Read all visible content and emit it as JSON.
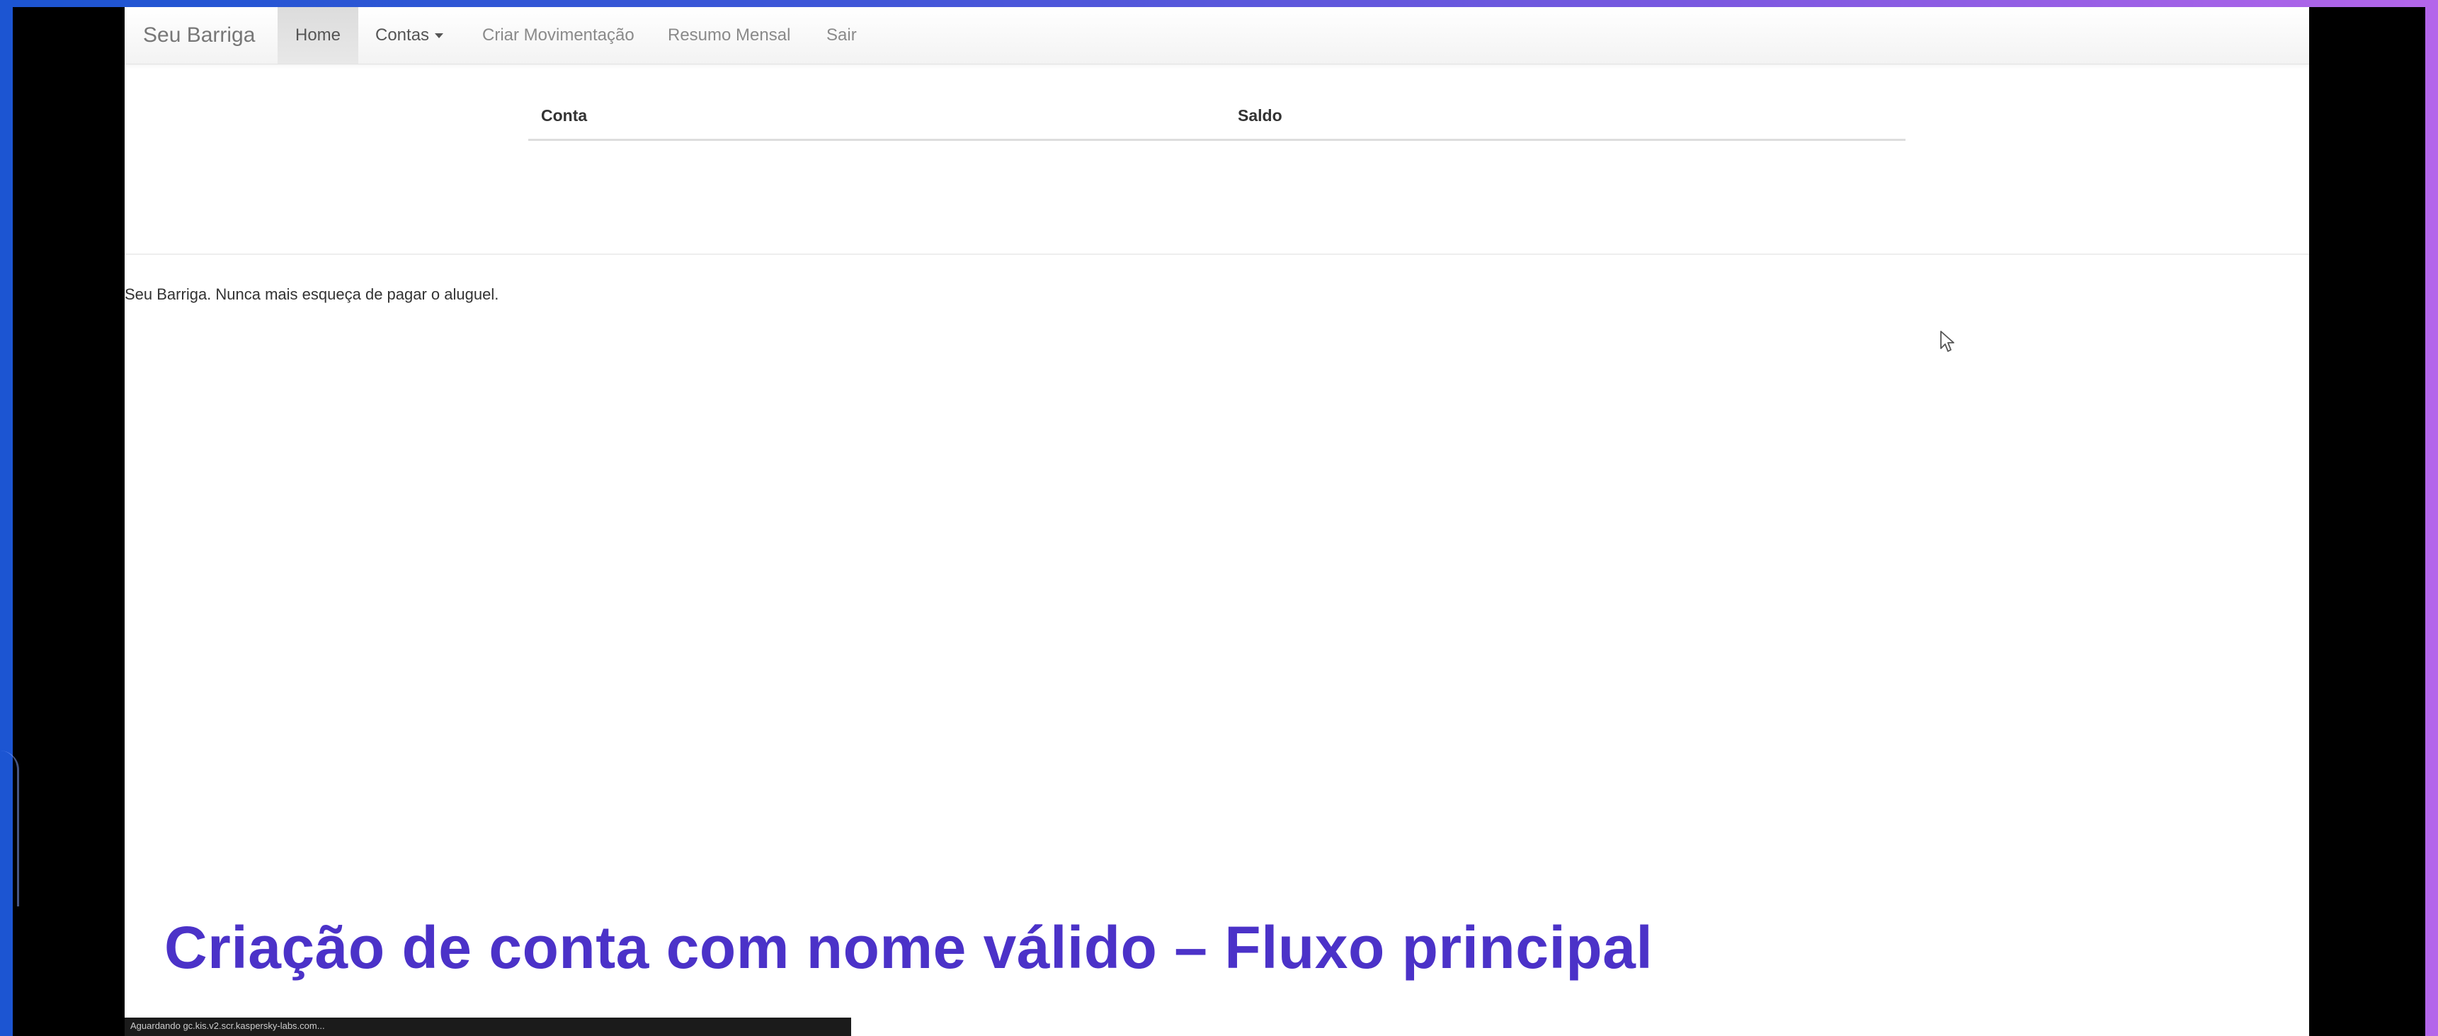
{
  "navbar": {
    "brand": "Seu Barriga",
    "items": [
      {
        "label": "Home",
        "active": true
      },
      {
        "label": "Contas"
      },
      {
        "label": "Criar Movimentação"
      },
      {
        "label": "Resumo Mensal"
      },
      {
        "label": "Sair"
      }
    ]
  },
  "table": {
    "columns": [
      "Conta",
      "Saldo"
    ]
  },
  "footer": {
    "text": "Seu Barriga. Nunca mais esqueça de pagar o aluguel."
  },
  "caption": "Criação de conta com nome válido – Fluxo principal",
  "status_bar": {
    "text": "Aguardando gc.kis.v2.scr.kaspersky-labs.com..."
  },
  "icons": {
    "cursor": "mouse-pointer-icon",
    "dropdown": "caret-down-icon"
  },
  "colors": {
    "caption": "#4b32c8",
    "gradient_start": "#1c55d2",
    "gradient_end": "#b466ea",
    "navbar_active_bg": "#dcdcdc"
  }
}
